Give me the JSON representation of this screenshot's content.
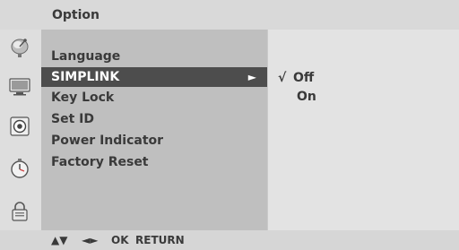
{
  "header": {
    "title": "Option"
  },
  "icons": [
    "satellite-dish-icon",
    "tv-picture-icon",
    "speaker-sound-icon",
    "clock-timer-icon",
    "lock-icon"
  ],
  "menu": {
    "items": [
      {
        "label": "Language"
      },
      {
        "label": "SIMPLINK",
        "arrow": "►"
      },
      {
        "label": "Key Lock"
      },
      {
        "label": "Set ID"
      },
      {
        "label": "Power Indicator"
      },
      {
        "label": "Factory Reset"
      }
    ]
  },
  "submenu": {
    "check": "√",
    "options": [
      {
        "label": "Off"
      },
      {
        "label": "On"
      }
    ]
  },
  "footer": {
    "updown": "▲▼",
    "leftright": "◄►",
    "ok": "OK",
    "return": "RETURN"
  },
  "colors": {
    "selected_bg": "#4d4d4d",
    "menu_bg": "#bfbfbf",
    "panel_bg": "#e3e3e3"
  }
}
